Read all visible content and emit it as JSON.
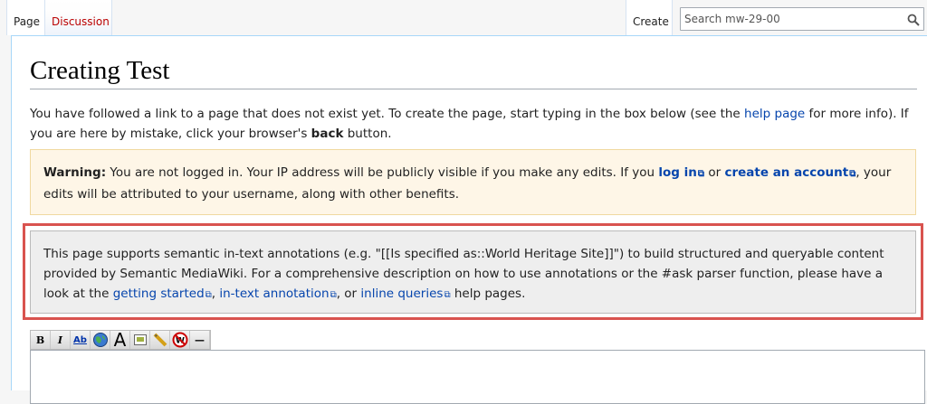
{
  "tabs": {
    "page": "Page",
    "discussion": "Discussion",
    "create": "Create"
  },
  "search": {
    "placeholder": "Search mw-29-00"
  },
  "title": "Creating Test",
  "intro": {
    "part1": "You have followed a link to a page that does not exist yet. To create the page, start typing in the box below (see the ",
    "help_link": "help page",
    "part2": " for more info). If you are here by mistake, click your browser's ",
    "back": "back",
    "part3": " button."
  },
  "warning": {
    "label": "Warning:",
    "part1": " You are not logged in. Your IP address will be publicly visible if you make any edits. If you ",
    "login_link": "log in",
    "part2": " or ",
    "create_account_link": "create an account",
    "part3": ", your edits will be attributed to your username, along with other benefits."
  },
  "smw_notice": {
    "part1": "This page supports semantic in-text annotations (e.g. \"[[Is specified as::World Heritage Site]]\") to build structured and queryable content provided by Semantic MediaWiki. For a comprehensive description on how to use annotations or the #ask parser function, please have a look at the ",
    "getting_started_link": "getting started",
    "sep1": ", ",
    "in_text_link": "in-text annotation",
    "sep2": ", or ",
    "inline_queries_link": "inline queries",
    "part2": " help pages."
  },
  "toolbar": {
    "bold": "B",
    "italic": "I",
    "link": "Ab",
    "big": "A",
    "hr": "—"
  },
  "editor": {
    "value": ""
  },
  "colors": {
    "link": "#0645ad",
    "redlink": "#ba0000",
    "highlight_border": "#d9534f",
    "warning_bg": "#fef6e7"
  }
}
